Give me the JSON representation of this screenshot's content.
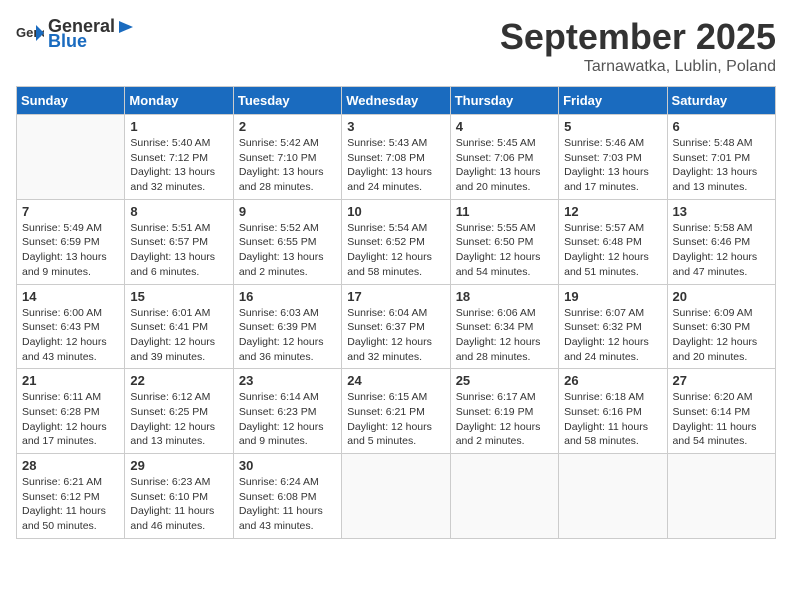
{
  "header": {
    "logo_general": "General",
    "logo_blue": "Blue",
    "month_title": "September 2025",
    "location": "Tarnawatka, Lublin, Poland"
  },
  "weekdays": [
    "Sunday",
    "Monday",
    "Tuesday",
    "Wednesday",
    "Thursday",
    "Friday",
    "Saturday"
  ],
  "weeks": [
    [
      {
        "day": "",
        "info": ""
      },
      {
        "day": "1",
        "info": "Sunrise: 5:40 AM\nSunset: 7:12 PM\nDaylight: 13 hours\nand 32 minutes."
      },
      {
        "day": "2",
        "info": "Sunrise: 5:42 AM\nSunset: 7:10 PM\nDaylight: 13 hours\nand 28 minutes."
      },
      {
        "day": "3",
        "info": "Sunrise: 5:43 AM\nSunset: 7:08 PM\nDaylight: 13 hours\nand 24 minutes."
      },
      {
        "day": "4",
        "info": "Sunrise: 5:45 AM\nSunset: 7:06 PM\nDaylight: 13 hours\nand 20 minutes."
      },
      {
        "day": "5",
        "info": "Sunrise: 5:46 AM\nSunset: 7:03 PM\nDaylight: 13 hours\nand 17 minutes."
      },
      {
        "day": "6",
        "info": "Sunrise: 5:48 AM\nSunset: 7:01 PM\nDaylight: 13 hours\nand 13 minutes."
      }
    ],
    [
      {
        "day": "7",
        "info": "Sunrise: 5:49 AM\nSunset: 6:59 PM\nDaylight: 13 hours\nand 9 minutes."
      },
      {
        "day": "8",
        "info": "Sunrise: 5:51 AM\nSunset: 6:57 PM\nDaylight: 13 hours\nand 6 minutes."
      },
      {
        "day": "9",
        "info": "Sunrise: 5:52 AM\nSunset: 6:55 PM\nDaylight: 13 hours\nand 2 minutes."
      },
      {
        "day": "10",
        "info": "Sunrise: 5:54 AM\nSunset: 6:52 PM\nDaylight: 12 hours\nand 58 minutes."
      },
      {
        "day": "11",
        "info": "Sunrise: 5:55 AM\nSunset: 6:50 PM\nDaylight: 12 hours\nand 54 minutes."
      },
      {
        "day": "12",
        "info": "Sunrise: 5:57 AM\nSunset: 6:48 PM\nDaylight: 12 hours\nand 51 minutes."
      },
      {
        "day": "13",
        "info": "Sunrise: 5:58 AM\nSunset: 6:46 PM\nDaylight: 12 hours\nand 47 minutes."
      }
    ],
    [
      {
        "day": "14",
        "info": "Sunrise: 6:00 AM\nSunset: 6:43 PM\nDaylight: 12 hours\nand 43 minutes."
      },
      {
        "day": "15",
        "info": "Sunrise: 6:01 AM\nSunset: 6:41 PM\nDaylight: 12 hours\nand 39 minutes."
      },
      {
        "day": "16",
        "info": "Sunrise: 6:03 AM\nSunset: 6:39 PM\nDaylight: 12 hours\nand 36 minutes."
      },
      {
        "day": "17",
        "info": "Sunrise: 6:04 AM\nSunset: 6:37 PM\nDaylight: 12 hours\nand 32 minutes."
      },
      {
        "day": "18",
        "info": "Sunrise: 6:06 AM\nSunset: 6:34 PM\nDaylight: 12 hours\nand 28 minutes."
      },
      {
        "day": "19",
        "info": "Sunrise: 6:07 AM\nSunset: 6:32 PM\nDaylight: 12 hours\nand 24 minutes."
      },
      {
        "day": "20",
        "info": "Sunrise: 6:09 AM\nSunset: 6:30 PM\nDaylight: 12 hours\nand 20 minutes."
      }
    ],
    [
      {
        "day": "21",
        "info": "Sunrise: 6:11 AM\nSunset: 6:28 PM\nDaylight: 12 hours\nand 17 minutes."
      },
      {
        "day": "22",
        "info": "Sunrise: 6:12 AM\nSunset: 6:25 PM\nDaylight: 12 hours\nand 13 minutes."
      },
      {
        "day": "23",
        "info": "Sunrise: 6:14 AM\nSunset: 6:23 PM\nDaylight: 12 hours\nand 9 minutes."
      },
      {
        "day": "24",
        "info": "Sunrise: 6:15 AM\nSunset: 6:21 PM\nDaylight: 12 hours\nand 5 minutes."
      },
      {
        "day": "25",
        "info": "Sunrise: 6:17 AM\nSunset: 6:19 PM\nDaylight: 12 hours\nand 2 minutes."
      },
      {
        "day": "26",
        "info": "Sunrise: 6:18 AM\nSunset: 6:16 PM\nDaylight: 11 hours\nand 58 minutes."
      },
      {
        "day": "27",
        "info": "Sunrise: 6:20 AM\nSunset: 6:14 PM\nDaylight: 11 hours\nand 54 minutes."
      }
    ],
    [
      {
        "day": "28",
        "info": "Sunrise: 6:21 AM\nSunset: 6:12 PM\nDaylight: 11 hours\nand 50 minutes."
      },
      {
        "day": "29",
        "info": "Sunrise: 6:23 AM\nSunset: 6:10 PM\nDaylight: 11 hours\nand 46 minutes."
      },
      {
        "day": "30",
        "info": "Sunrise: 6:24 AM\nSunset: 6:08 PM\nDaylight: 11 hours\nand 43 minutes."
      },
      {
        "day": "",
        "info": ""
      },
      {
        "day": "",
        "info": ""
      },
      {
        "day": "",
        "info": ""
      },
      {
        "day": "",
        "info": ""
      }
    ]
  ]
}
